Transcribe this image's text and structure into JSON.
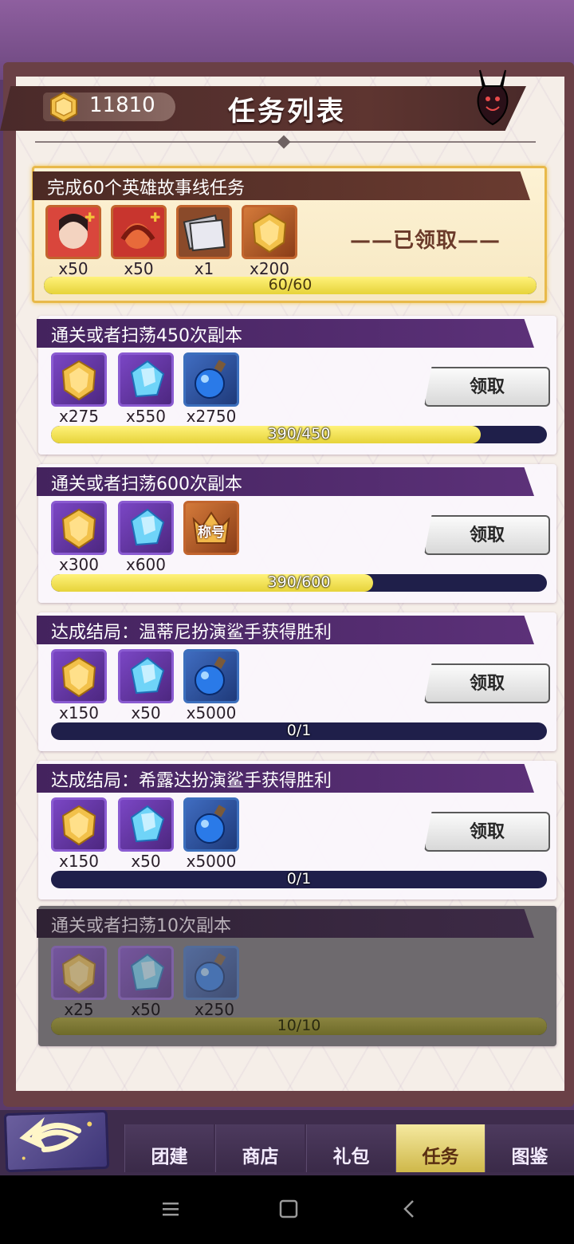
{
  "currency": {
    "value": "11810",
    "icon": "gold-coin-icon"
  },
  "title": "任务列表",
  "tasks": [
    {
      "name": "完成60个英雄故事线任务",
      "state": "claimed",
      "status_label": "——已领取——",
      "progress": {
        "text": "60/60",
        "current": 60,
        "total": 60
      },
      "rewards": [
        {
          "icon": "hero-fragment-icon",
          "qty": "x50"
        },
        {
          "icon": "hero-fragment-icon",
          "qty": "x50"
        },
        {
          "icon": "card-pack-icon",
          "qty": "x1"
        },
        {
          "icon": "gold-coin-icon",
          "qty": "x200"
        }
      ]
    },
    {
      "name": "通关或者扫荡450次副本",
      "state": "claimable",
      "button": "领取",
      "progress": {
        "text": "390/450",
        "current": 390,
        "total": 450
      },
      "rewards": [
        {
          "icon": "gold-coin-icon",
          "qty": "x275"
        },
        {
          "icon": "blue-crystal-icon",
          "qty": "x550"
        },
        {
          "icon": "blue-potion-icon",
          "qty": "x2750"
        }
      ]
    },
    {
      "name": "通关或者扫荡600次副本",
      "state": "claimable",
      "button": "领取",
      "progress": {
        "text": "390/600",
        "current": 390,
        "total": 600
      },
      "rewards": [
        {
          "icon": "gold-coin-icon",
          "qty": "x300"
        },
        {
          "icon": "blue-crystal-icon",
          "qty": "x600"
        },
        {
          "icon": "title-badge-icon",
          "label": "称号",
          "qty": ""
        }
      ]
    },
    {
      "name": "达成结局：温蒂尼扮演鲨手获得胜利",
      "state": "claimable",
      "button": "领取",
      "progress": {
        "text": "0/1",
        "current": 0,
        "total": 1
      },
      "rewards": [
        {
          "icon": "gold-coin-icon",
          "qty": "x150"
        },
        {
          "icon": "blue-crystal-icon",
          "qty": "x50"
        },
        {
          "icon": "blue-potion-icon",
          "qty": "x5000"
        }
      ]
    },
    {
      "name": "达成结局：希露达扮演鲨手获得胜利",
      "state": "claimable",
      "button": "领取",
      "progress": {
        "text": "0/1",
        "current": 0,
        "total": 1
      },
      "rewards": [
        {
          "icon": "gold-coin-icon",
          "qty": "x150"
        },
        {
          "icon": "blue-crystal-icon",
          "qty": "x50"
        },
        {
          "icon": "blue-potion-icon",
          "qty": "x5000"
        }
      ]
    },
    {
      "name": "通关或者扫荡10次副本",
      "state": "completed",
      "progress": {
        "text": "10/10",
        "current": 10,
        "total": 10
      },
      "rewards": [
        {
          "icon": "gold-coin-icon",
          "qty": "x25"
        },
        {
          "icon": "blue-crystal-icon",
          "qty": "x50"
        },
        {
          "icon": "blue-potion-icon",
          "qty": "x250"
        }
      ]
    }
  ],
  "tabs": [
    "团建",
    "商店",
    "礼包",
    "任务",
    "图鉴"
  ],
  "active_tab": "任务",
  "colors": {
    "progress_fill": "#e6d33a",
    "progress_track": "#1f1f4a",
    "task_header": "#44235e",
    "active_tab": "#cfb84a"
  }
}
